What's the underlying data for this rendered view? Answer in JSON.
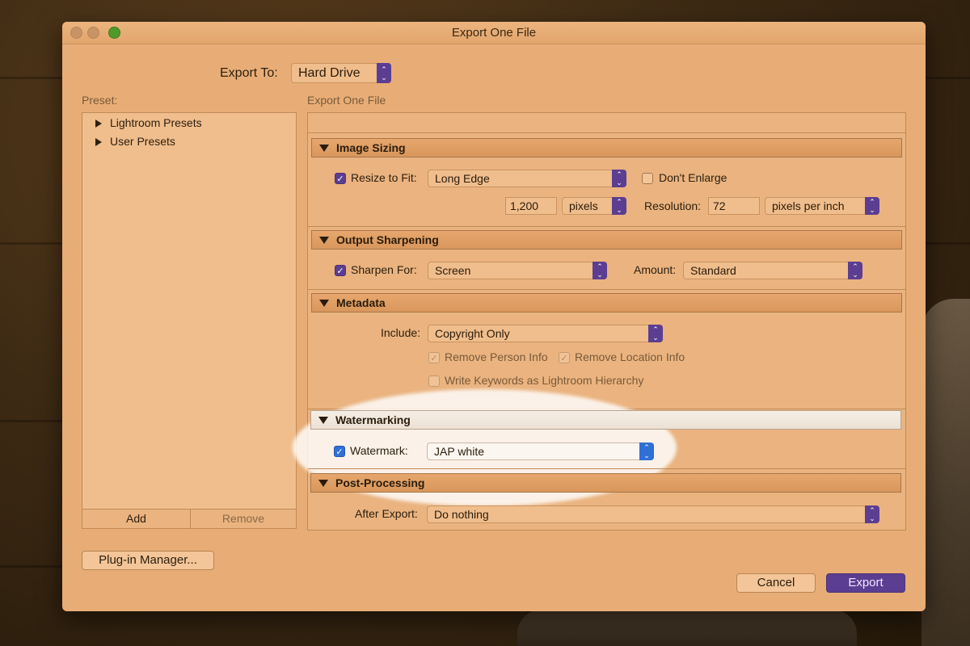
{
  "window": {
    "title": "Export One File"
  },
  "export_to": {
    "label": "Export To:",
    "value": "Hard Drive"
  },
  "preset": {
    "label": "Preset:",
    "items": [
      "Lightroom Presets",
      "User Presets"
    ],
    "add_label": "Add",
    "remove_label": "Remove"
  },
  "panel": {
    "header": "Export One File"
  },
  "image_sizing": {
    "title": "Image Sizing",
    "resize_label": "Resize to Fit:",
    "resize_checked": true,
    "resize_mode": "Long Edge",
    "dont_enlarge_label": "Don't Enlarge",
    "dont_enlarge_checked": false,
    "size_value": "1,200",
    "size_unit": "pixels",
    "resolution_label": "Resolution:",
    "resolution_value": "72",
    "resolution_unit": "pixels per inch"
  },
  "output_sharpening": {
    "title": "Output Sharpening",
    "sharpen_label": "Sharpen For:",
    "sharpen_checked": true,
    "sharpen_value": "Screen",
    "amount_label": "Amount:",
    "amount_value": "Standard"
  },
  "metadata": {
    "title": "Metadata",
    "include_label": "Include:",
    "include_value": "Copyright Only",
    "remove_person_label": "Remove Person Info",
    "remove_location_label": "Remove Location Info",
    "keywords_label": "Write Keywords as Lightroom Hierarchy"
  },
  "watermarking": {
    "title": "Watermarking",
    "watermark_label": "Watermark:",
    "watermark_checked": true,
    "watermark_value": "JAP white"
  },
  "post_processing": {
    "title": "Post-Processing",
    "after_export_label": "After Export:",
    "after_export_value": "Do nothing"
  },
  "footer": {
    "plugin_manager": "Plug-in Manager...",
    "cancel": "Cancel",
    "export": "Export"
  },
  "colors": {
    "accent": "#5b3e91",
    "accent_blue": "#2f6fd6",
    "window_bg": "#e8ad76"
  },
  "icons": {
    "check": "✓",
    "stepper": "⌃⌄"
  }
}
